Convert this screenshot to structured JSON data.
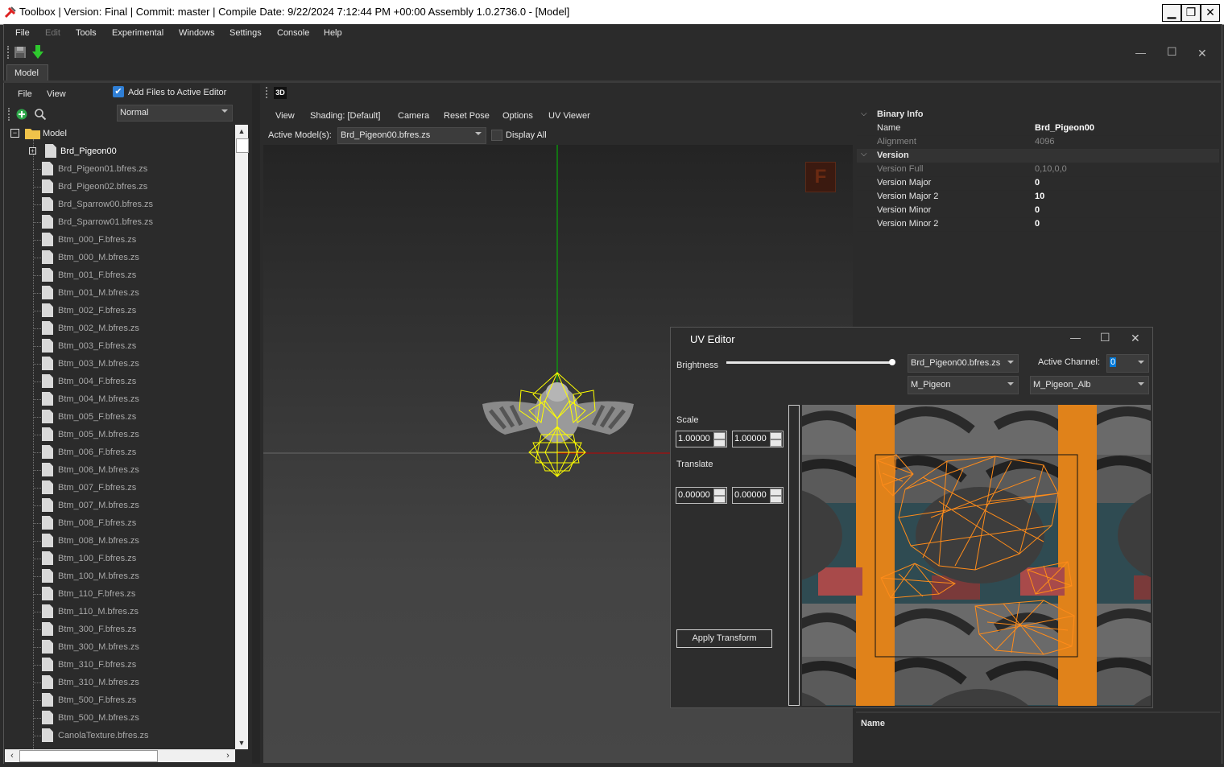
{
  "window": {
    "title": "Toolbox | Version: Final | Commit: master | Compile Date: 9/22/2024 7:12:44 PM +00:00 Assembly 1.0.2736.0 - [Model]",
    "min_label": "▁",
    "restore_label": "❐",
    "close_label": "✕"
  },
  "menu": {
    "items": [
      "File",
      "Edit",
      "Tools",
      "Experimental",
      "Windows",
      "Settings",
      "Console",
      "Help"
    ]
  },
  "doc_tab": {
    "label": "Model"
  },
  "mdi_controls": {
    "min": "—",
    "max": "☐",
    "close": "✕"
  },
  "outliner": {
    "menu": [
      "File",
      "View"
    ],
    "add_files_label": "Add Files to Active Editor",
    "add_files_checked": true,
    "mode_value": "Normal",
    "root_label": "Model",
    "selected_child": "Brd_Pigeon00",
    "files": [
      "Brd_Pigeon01.bfres.zs",
      "Brd_Pigeon02.bfres.zs",
      "Brd_Sparrow00.bfres.zs",
      "Brd_Sparrow01.bfres.zs",
      "Btm_000_F.bfres.zs",
      "Btm_000_M.bfres.zs",
      "Btm_001_F.bfres.zs",
      "Btm_001_M.bfres.zs",
      "Btm_002_F.bfres.zs",
      "Btm_002_M.bfres.zs",
      "Btm_003_F.bfres.zs",
      "Btm_003_M.bfres.zs",
      "Btm_004_F.bfres.zs",
      "Btm_004_M.bfres.zs",
      "Btm_005_F.bfres.zs",
      "Btm_005_M.bfres.zs",
      "Btm_006_F.bfres.zs",
      "Btm_006_M.bfres.zs",
      "Btm_007_F.bfres.zs",
      "Btm_007_M.bfres.zs",
      "Btm_008_F.bfres.zs",
      "Btm_008_M.bfres.zs",
      "Btm_100_F.bfres.zs",
      "Btm_100_M.bfres.zs",
      "Btm_110_F.bfres.zs",
      "Btm_110_M.bfres.zs",
      "Btm_300_F.bfres.zs",
      "Btm_300_M.bfres.zs",
      "Btm_310_F.bfres.zs",
      "Btm_310_M.bfres.zs",
      "Btm_500_F.bfres.zs",
      "Btm_500_M.bfres.zs",
      "CanolaTexture.bfres.zs"
    ]
  },
  "viewport": {
    "tab_label": "3D",
    "menu": [
      "View",
      "Shading: [Default]",
      "Camera",
      "Reset Pose",
      "Options",
      "UV Viewer"
    ],
    "active_models_label": "Active Model(s):",
    "active_model_value": "Brd_Pigeon00.bfres.zs",
    "display_all_label": "Display All",
    "badge": "F"
  },
  "properties": {
    "binary_info_header": "Binary Info",
    "version_header": "Version",
    "rows": [
      {
        "key": "Name",
        "value": "Brd_Pigeon00"
      },
      {
        "key": "Alignment",
        "value": "4096"
      },
      {
        "key": "Version Full",
        "value": "0,10,0,0"
      },
      {
        "key": "Version Major",
        "value": "0"
      },
      {
        "key": "Version Major 2",
        "value": "10"
      },
      {
        "key": "Version Minor",
        "value": "0"
      },
      {
        "key": "Version Minor 2",
        "value": "0"
      }
    ],
    "footer_label": "Name"
  },
  "uv_editor": {
    "title": "UV Editor",
    "brightness_label": "Brightness",
    "brightness_level": 1.0,
    "model_select": "Brd_Pigeon00.bfres.zs",
    "active_channel_label": "Active Channel:",
    "active_channel_value": "0",
    "material_select": "M_Pigeon",
    "texture_select": "M_Pigeon_Alb",
    "scale_label": "Scale",
    "scale_x": "1.00000",
    "scale_y": "1.00000",
    "translate_label": "Translate",
    "translate_x": "0.00000",
    "translate_y": "0.00000",
    "apply_label": "Apply Transform"
  },
  "colors": {
    "accent_blue": "#0078d7",
    "wire_yellow": "#ffff00",
    "uv_orange": "#ff8c1a",
    "axis_green": "#00c000",
    "axis_red": "#c00000"
  }
}
